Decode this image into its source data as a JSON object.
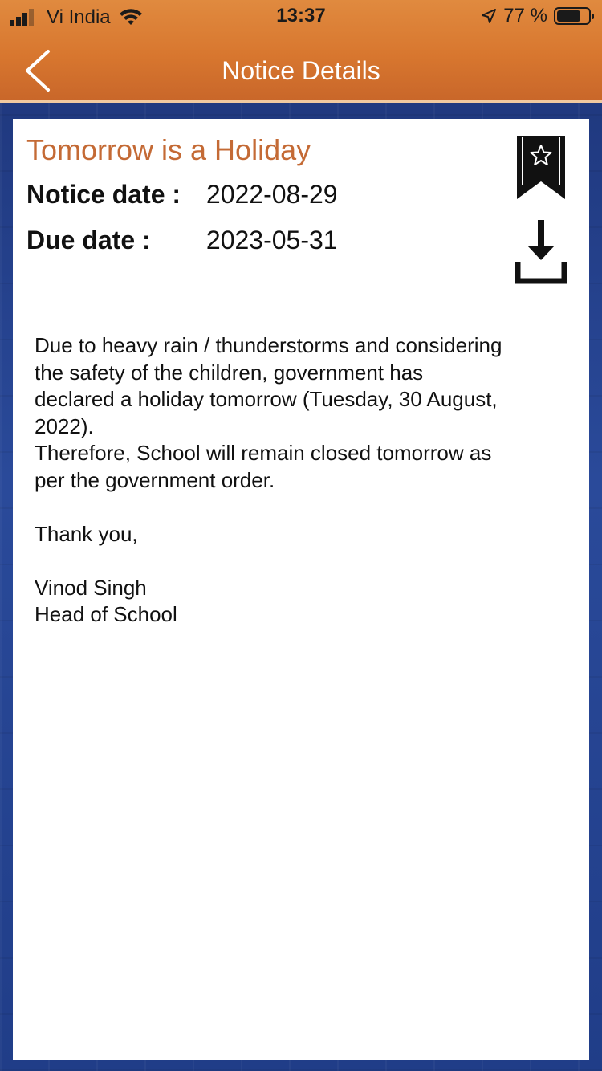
{
  "status_bar": {
    "carrier": "Vi India",
    "time": "13:37",
    "battery_percent": "77 %",
    "battery_level": 0.77,
    "icons": [
      "signal-icon",
      "wifi-icon",
      "location-arrow-icon",
      "battery-icon"
    ]
  },
  "nav": {
    "title": "Notice Details",
    "back_icon": "chevron-left-icon"
  },
  "notice": {
    "title": "Tomorrow is a Holiday",
    "notice_date_label": "Notice date :",
    "notice_date": "2022-08-29",
    "due_date_label": "Due date :",
    "due_date": "2023-05-31",
    "bookmark_icon": "bookmark-star-icon",
    "download_icon": "download-icon",
    "body": {
      "line1": "Due to heavy rain / thunderstorms and considering",
      "line2": "the safety of the children, government has",
      "line3": "declared a holiday tomorrow (Tuesday, 30 August,",
      "line4": "2022).",
      "line5": "Therefore, School will remain closed tomorrow as",
      "line6": "per the government order.",
      "line7": "Thank you,",
      "line8": "Vinod Singh",
      "line9": "Head of School"
    }
  },
  "colors": {
    "header_orange": "#d8772f",
    "title_orange": "#c46a35",
    "background_blue": "#24408a"
  }
}
